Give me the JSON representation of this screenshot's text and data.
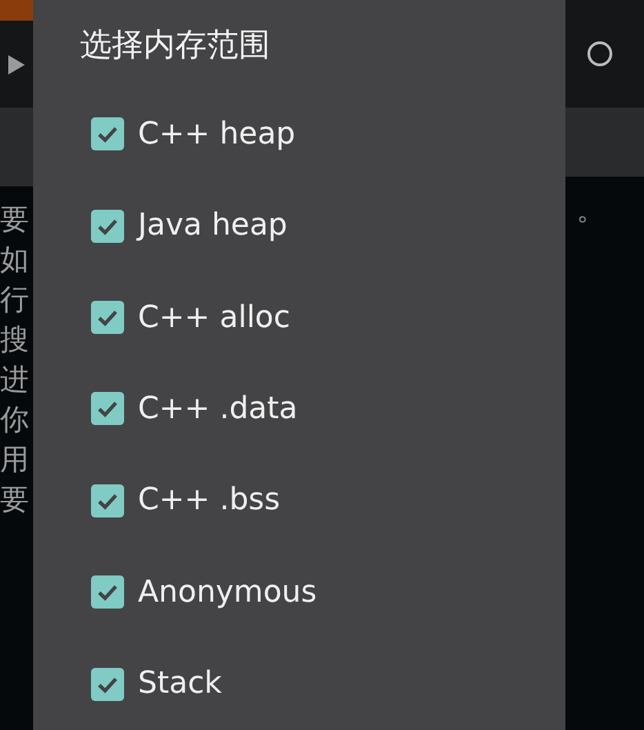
{
  "background": {
    "left_lines": [
      "要",
      "如",
      "行",
      "搜",
      "进",
      "你",
      "用",
      "要"
    ],
    "right_lines": [
      "。"
    ]
  },
  "dialog": {
    "title": "选择内存范围",
    "options": [
      {
        "label": "C++ heap",
        "checked": true
      },
      {
        "label": "Java heap",
        "checked": true
      },
      {
        "label": "C++ alloc",
        "checked": true
      },
      {
        "label": "C++ .data",
        "checked": true
      },
      {
        "label": "C++ .bss",
        "checked": true
      },
      {
        "label": "Anonymous",
        "checked": true
      },
      {
        "label": "Stack",
        "checked": true
      }
    ]
  }
}
